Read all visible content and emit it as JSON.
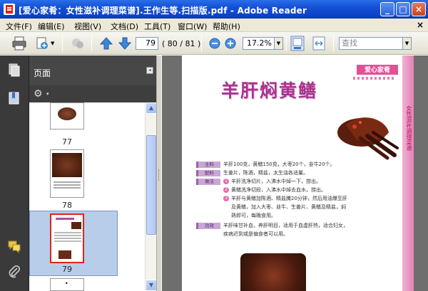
{
  "window": {
    "title": "[爱心家肴：女性滋补调理菜谱].王作生等.扫描版.pdf - Adobe Reader",
    "min_label": "_",
    "max_label": "□",
    "close_label": "×"
  },
  "menu": {
    "items": [
      "文件(F)",
      "编辑(E)",
      "视图(V)",
      "文档(D)",
      "工具(T)",
      "窗口(W)",
      "帮助(H)"
    ],
    "close_label": "×"
  },
  "toolbar": {
    "current_page": "79",
    "page_count": "( 80 / 81 )",
    "zoom": "17.2%",
    "search_placeholder": "查找"
  },
  "nav_panel": {
    "title": "页面",
    "collapse_label": "◂",
    "options_arrow": "▾"
  },
  "thumbnails": [
    {
      "label": "77"
    },
    {
      "label": "78"
    },
    {
      "label": "79",
      "selected": true
    },
    {
      "label": "•"
    }
  ],
  "document": {
    "brand": "爱心家肴",
    "dish_title": "羊肝焖黄鳝",
    "side_text": "女性滋补调理菜谱",
    "rows": [
      {
        "tag": "主料",
        "text": "羊肝100克，黄鳝150克，大枣20个，韭牛20个。"
      },
      {
        "tag": "配料",
        "text": "生姜片，陈酒，精盐，太生油各适量。"
      },
      {
        "tag": "做法",
        "text": "羊肝洗净切片，入沸水中焯一下，捞出。",
        "step": "1"
      },
      {
        "tag": "",
        "text": "黄鳝洗净切段，入沸水中焯去血水，捞出。",
        "step": "2"
      },
      {
        "tag": "",
        "text": "羊肝与黄鳝加陈酒、精盐腌20分钟，然后用油爆至肝",
        "step": "3"
      },
      {
        "tag": "",
        "text": "及黄鳝，加入大枣、韭牛、生姜片、黄鳝及精盐，焖"
      },
      {
        "tag": "",
        "text": "熟即可，每晚食用。"
      },
      {
        "tag": "功效",
        "text": "羊肝味甘补血，养肝明目，适用于血虚肝热，适合妇女，"
      },
      {
        "tag": "",
        "text": "疾病迟到或是偏食者可以用。"
      }
    ]
  },
  "colors": {
    "title_bar": "#1451d6",
    "panel_dark": "#474747",
    "accent_pink": "#e25096",
    "dish_title": "#a8348f"
  }
}
